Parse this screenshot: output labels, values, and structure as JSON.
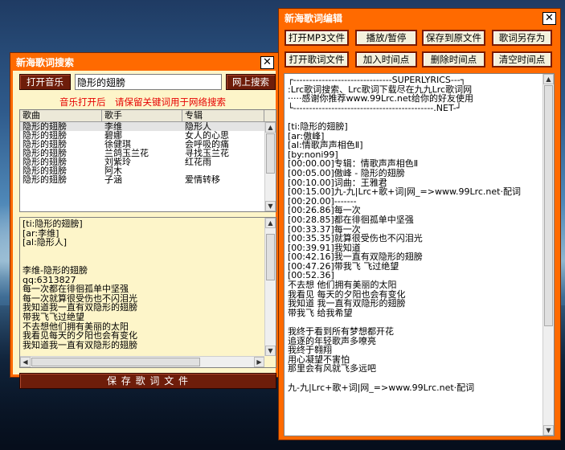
{
  "search_window": {
    "title": "新海歌词搜索",
    "open_music_label": "打开音乐",
    "search_value": "隐形的翅膀",
    "web_search_label": "网上搜索",
    "hint": "音乐打开后　请保留关键词用于网络搜索",
    "columns": [
      "歌曲",
      "歌手",
      "专辑"
    ],
    "rows": [
      {
        "song": "隐形的翅膀",
        "artist": "李维",
        "album": "隐形人"
      },
      {
        "song": "隐形的翅膀",
        "artist": "碧娜",
        "album": "女人的心思"
      },
      {
        "song": "隐形的翅膀",
        "artist": "徐健琪",
        "album": "会呼吸的痛"
      },
      {
        "song": "隐形的翅膀",
        "artist": "兰鸽玉兰花",
        "album": "寻找玉兰花"
      },
      {
        "song": "隐形的翅膀",
        "artist": "刘紫玲",
        "album": "红花雨"
      },
      {
        "song": "隐形的翅膀",
        "artist": "阿木",
        "album": ""
      },
      {
        "song": "隐形的翅膀",
        "artist": "子涵",
        "album": "爱情转移"
      }
    ],
    "lyrics": [
      "[ti:隐形的翅膀]",
      "[ar:李维]",
      "[al:隐形人]",
      "",
      "",
      "李维-隐形的翅膀",
      "qq:6313827",
      "每一次都在徘徊孤单中坚强",
      "每一次就算很受伤也不闪泪光",
      "我知道我一直有双隐形的翅膀",
      "带我飞飞过绝望",
      "不去想他们拥有美丽的太阳",
      "我看见每天的夕阳也会有变化",
      "我知道我一直有双隐形的翅膀"
    ],
    "save_label": "保 存 歌 词 文 件"
  },
  "editor_window": {
    "title": "新海歌词编辑",
    "buttons": [
      "打开MP3文件",
      "播放/暂停",
      "保存到原文件",
      "歌词另存为",
      "打开歌词文件",
      "加入时间点",
      "删除时间点",
      "清空时间点"
    ],
    "lines": [
      "┌-------------------------------SUPERLYRICS---┐",
      ":Lrc歌词搜索、Lrc歌词下载尽在九九Lrc歌词网",
      "·····感谢你推荐www.99Lrc.net给你的好友使用",
      "└--------------------------------------------.NET-┘",
      "",
      "[ti:隐形的翅膀]",
      "[ar:傲峰]",
      "[al:情歌声声相色Ⅱ]",
      "[by:noni99]",
      "[00:00.00]专辑：情歌声声相色Ⅱ",
      "[00:05.00]傲峰 - 隐形的翅膀",
      "[00:10.00]词曲：王雅君",
      "[00:15.00]九-九|Lrc+歌+词|网_=>www.99Lrc.net·配词",
      "[00:20.00]-------",
      "[00:26.86]每一次",
      "[00:28.85]都在徘徊孤单中坚强",
      "[00:33.37]每一次",
      "[00:35.35]就算很受伤也不闪泪光",
      "[00:39.91]我知道",
      "[00:42.16]我一直有双隐形的翅膀",
      "[00:47.26]带我飞 飞过绝望",
      "[00:52.36]",
      "不去想 他们拥有美丽的太阳",
      "我看见 每天的夕阳也会有变化",
      "我知道 我一直有双隐形的翅膀",
      "带我飞 给我希望",
      "",
      "我终于看到所有梦想都开花",
      "追逐的年轻歌声多嘹亮",
      "我终于翱翔",
      "用心凝望不害怕",
      "那里会有风就飞多远吧",
      "",
      "九-九|Lrc+歌+词|网_=>www.99Lrc.net·配词"
    ]
  }
}
